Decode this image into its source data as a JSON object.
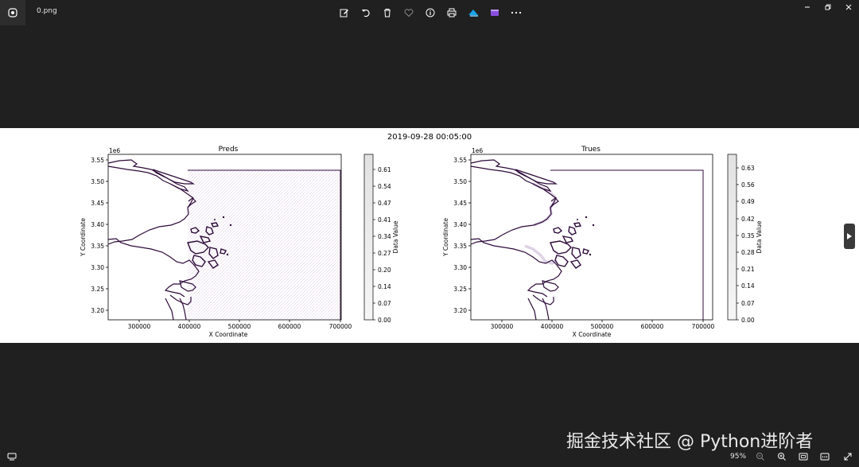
{
  "app": {
    "file_name": "0.png"
  },
  "toolbar": {
    "buttons": [
      {
        "icon": "edit-icon"
      },
      {
        "icon": "rotate-icon"
      },
      {
        "icon": "delete-icon"
      },
      {
        "icon": "favorite-heart-icon"
      },
      {
        "icon": "info-icon"
      },
      {
        "icon": "print-icon"
      },
      {
        "icon": "clipchamp-icon"
      },
      {
        "icon": "video-editor-icon"
      },
      {
        "icon": "more-icon"
      }
    ]
  },
  "figure": {
    "suptitle": "2019-09-28 00:05:00",
    "left_panel": {
      "title": "Preds",
      "xlabel": "X Coordinate",
      "ylabel": "Y Coordinate",
      "y_offset_label": "1e6",
      "xticks": [
        "300000",
        "400000",
        "500000",
        "600000",
        "700000"
      ],
      "yticks": [
        "3.55",
        "3.50",
        "3.45",
        "3.40",
        "3.35",
        "3.30",
        "3.25",
        "3.20"
      ],
      "colorbar_label": "Data Value",
      "colorbar_ticks": [
        "0.61",
        "0.54",
        "0.47",
        "0.41",
        "0.34",
        "0.27",
        "0.20",
        "0.14",
        "0.07",
        "0.00"
      ]
    },
    "right_panel": {
      "title": "Trues",
      "xlabel": "X Coordinate",
      "ylabel": "Y Coordinate",
      "y_offset_label": "1e6",
      "xticks": [
        "300000",
        "400000",
        "500000",
        "600000",
        "700000"
      ],
      "yticks": [
        "3.55",
        "3.50",
        "3.45",
        "3.40",
        "3.35",
        "3.30",
        "3.25",
        "3.20"
      ],
      "colorbar_label": "Data Value",
      "colorbar_ticks": [
        "0.63",
        "0.56",
        "0.49",
        "0.42",
        "0.35",
        "0.28",
        "0.21",
        "0.14",
        "0.07",
        "0.00"
      ]
    }
  },
  "status": {
    "zoom": "95%"
  },
  "watermark": "掘金技术社区 @ Python进阶者",
  "colors": {
    "background": "#202020",
    "contour": "#2d0a3a",
    "outline": "#000000"
  }
}
